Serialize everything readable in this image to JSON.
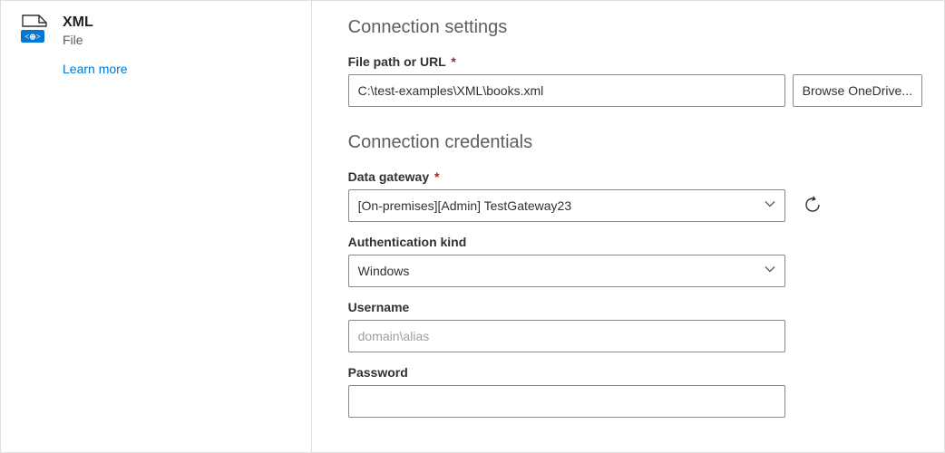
{
  "sidebar": {
    "title": "XML",
    "subtitle": "File",
    "learn_more": "Learn more"
  },
  "settings": {
    "heading": "Connection settings",
    "file_path": {
      "label": "File path or URL",
      "required_marker": "*",
      "value": "C:\\test-examples\\XML\\books.xml"
    },
    "browse_label": "Browse OneDrive..."
  },
  "credentials": {
    "heading": "Connection credentials",
    "gateway": {
      "label": "Data gateway",
      "required_marker": "*",
      "value": "[On-premises][Admin] TestGateway23"
    },
    "auth_kind": {
      "label": "Authentication kind",
      "value": "Windows"
    },
    "username": {
      "label": "Username",
      "placeholder": "domain\\alias",
      "value": ""
    },
    "password": {
      "label": "Password",
      "value": ""
    }
  }
}
